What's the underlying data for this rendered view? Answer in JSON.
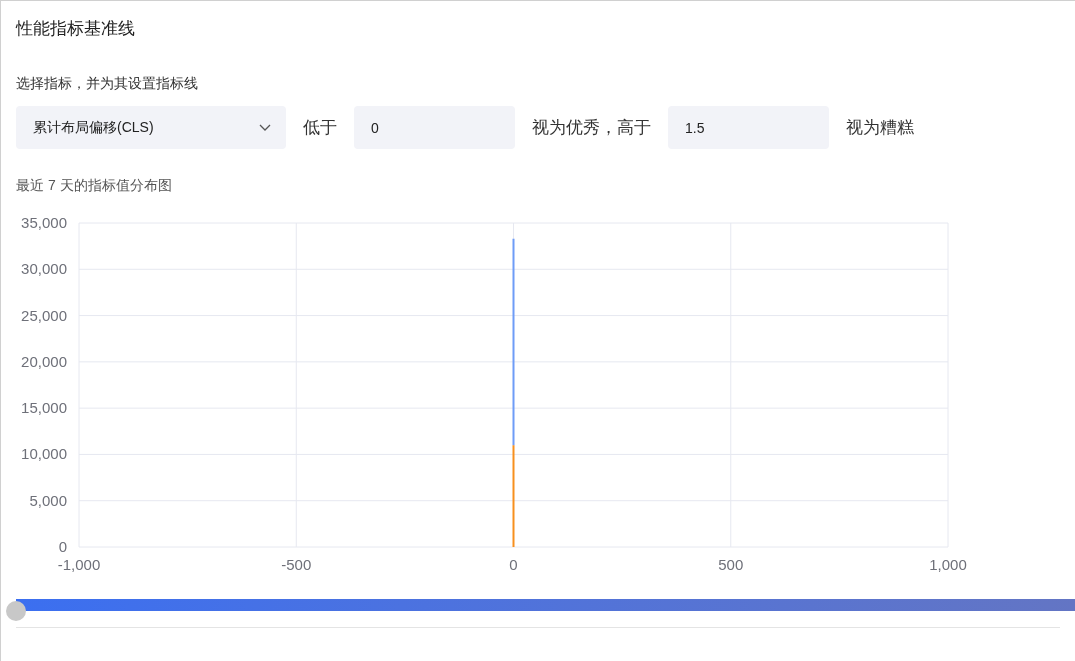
{
  "title": "性能指标基准线",
  "subtitle": "选择指标，并为其设置指标线",
  "metric_select": {
    "value": "累计布局偏移(CLS)"
  },
  "threshold_row": [
    {
      "kind": "label",
      "text": "低于"
    },
    {
      "kind": "field",
      "value": "0"
    },
    {
      "kind": "label",
      "text": "视为优秀，高于"
    },
    {
      "kind": "field",
      "value": "1.5"
    },
    {
      "kind": "label",
      "text": "视为糟糕"
    }
  ],
  "chart_title": "最近 7 天的指标值分布图",
  "chart_data": {
    "type": "bar",
    "x": [
      0
    ],
    "stacked": true,
    "grid": true,
    "xlim": [
      -1000,
      1000
    ],
    "ylim": [
      0,
      35000
    ],
    "xticks": [
      {
        "value": -1000,
        "label": "-1,000"
      },
      {
        "value": -500,
        "label": "-500"
      },
      {
        "value": 0,
        "label": "0"
      },
      {
        "value": 500,
        "label": "500"
      },
      {
        "value": 1000,
        "label": "1,000"
      }
    ],
    "yticks": [
      {
        "value": 0,
        "label": "0"
      },
      {
        "value": 5000,
        "label": "5,000"
      },
      {
        "value": 10000,
        "label": "10,000"
      },
      {
        "value": 15000,
        "label": "15,000"
      },
      {
        "value": 20000,
        "label": "20,000"
      },
      {
        "value": 25000,
        "label": "25,000"
      },
      {
        "value": 30000,
        "label": "30,000"
      },
      {
        "value": 35000,
        "label": "35,000"
      }
    ],
    "series": [
      {
        "color": "#f7901e",
        "values": [
          11000
        ]
      },
      {
        "color": "#6e9cf7",
        "values": [
          22300
        ]
      }
    ]
  },
  "range_slider": {
    "level": 0
  }
}
